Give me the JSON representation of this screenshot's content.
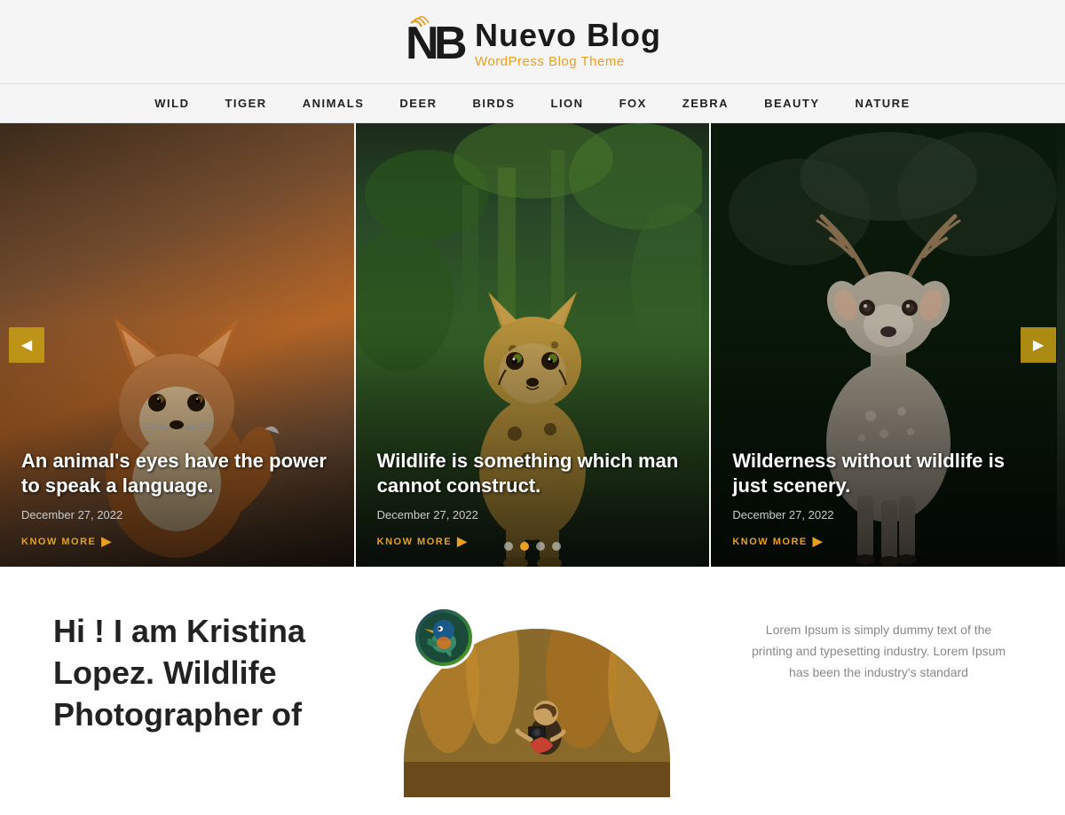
{
  "header": {
    "logo_title": "Nuevo Blog",
    "logo_subtitle": "WordPress Blog Theme"
  },
  "nav": {
    "items": [
      {
        "label": "WILD",
        "id": "wild"
      },
      {
        "label": "TIGER",
        "id": "tiger"
      },
      {
        "label": "ANIMALS",
        "id": "animals"
      },
      {
        "label": "DEER",
        "id": "deer"
      },
      {
        "label": "BIRDS",
        "id": "birds"
      },
      {
        "label": "LION",
        "id": "lion"
      },
      {
        "label": "FOX",
        "id": "fox"
      },
      {
        "label": "ZEBRA",
        "id": "zebra"
      },
      {
        "label": "BEAUTY",
        "id": "beauty"
      },
      {
        "label": "NATURE",
        "id": "nature"
      }
    ]
  },
  "slider": {
    "prev_label": "◀",
    "next_label": "▶",
    "panels": [
      {
        "title": "An animal's eyes have the power to speak a language.",
        "date": "December 27, 2022",
        "link_label": "KNOW MORE",
        "animal": "fox"
      },
      {
        "title": "Wildlife is something which man cannot construct.",
        "date": "December 27, 2022",
        "link_label": "KNOW MORE",
        "animal": "cheetah"
      },
      {
        "title": "Wilderness without wildlife is just scenery.",
        "date": "December 27, 2022",
        "link_label": "KNOW MORE",
        "animal": "deer"
      }
    ],
    "dots": [
      {
        "active": false
      },
      {
        "active": true
      },
      {
        "active": false
      },
      {
        "active": false
      }
    ]
  },
  "about": {
    "title": "Hi ! I am Kristina Lopez. Wildlife Photographer of",
    "lorem_text": "Lorem Ipsum is simply dummy text of the printing and typesetting industry. Lorem Ipsum has been the industry's standard"
  }
}
